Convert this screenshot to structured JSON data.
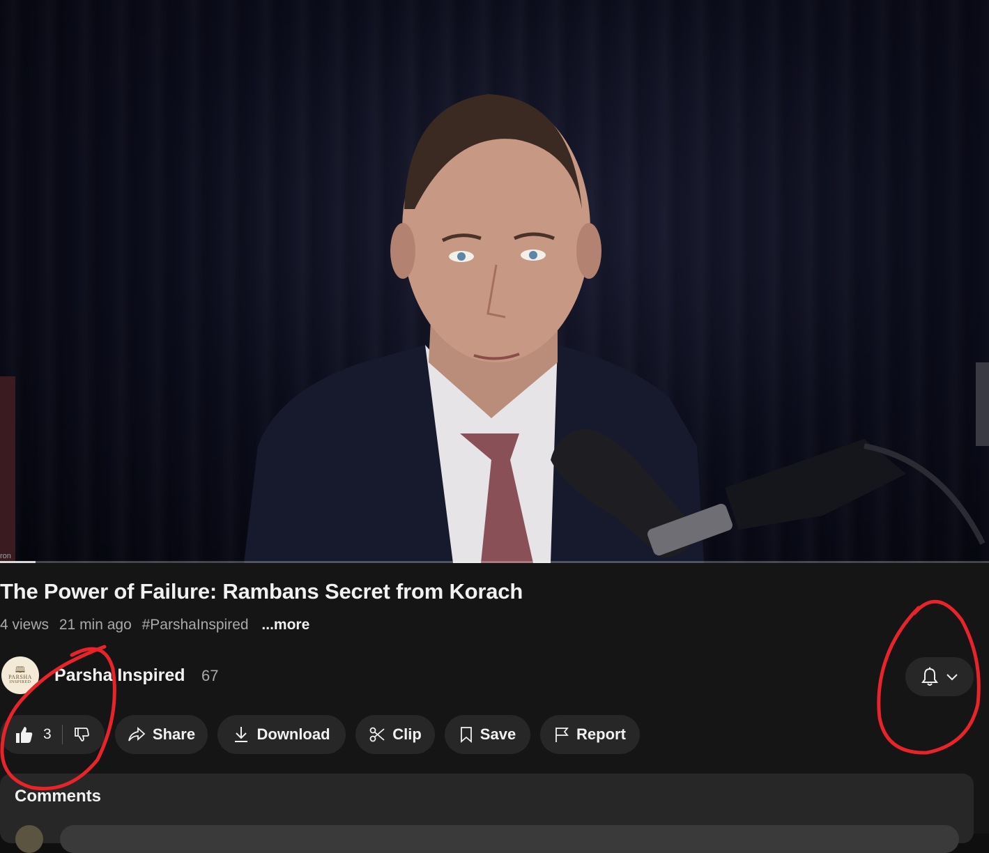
{
  "video": {
    "frame_label": "ron",
    "progress_percent": 3.6
  },
  "info": {
    "title": "The Power of Failure: Rambans Secret from Korach",
    "views": "4 views",
    "time_ago": "21 min ago",
    "hashtag": "#ParshaInspired",
    "more_label": "...more"
  },
  "channel": {
    "avatar_line1": "PARSHA",
    "avatar_line2": "INSPIRED",
    "name": "Parsha Inspired",
    "subscriber_count": "67",
    "bell_icon": "bell-icon",
    "dropdown_icon": "chevron-down-icon"
  },
  "actions": {
    "like_count": "3",
    "share_label": "Share",
    "download_label": "Download",
    "clip_label": "Clip",
    "save_label": "Save",
    "report_label": "Report"
  },
  "comments": {
    "title": "Comments"
  },
  "annotation": {
    "color": "#e8232a"
  },
  "colors": {
    "background": "#0f0f0f",
    "pill": "#272727",
    "muted_text": "#aaaaaa"
  }
}
